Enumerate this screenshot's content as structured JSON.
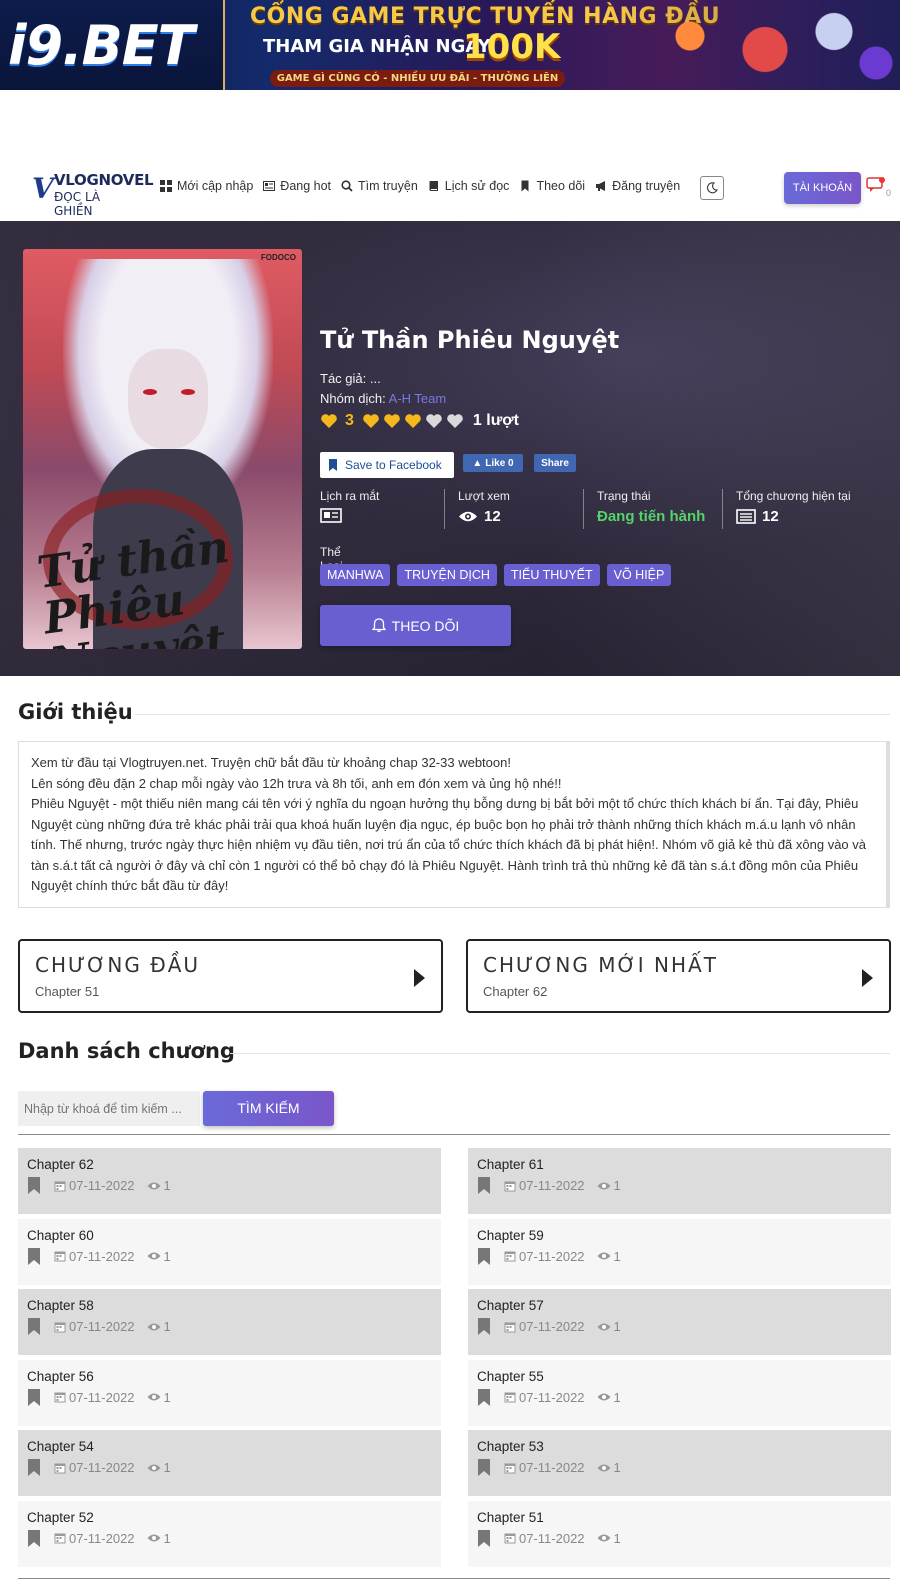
{
  "banner": {
    "brand": "i9.BET",
    "headline": "CỔNG GAME TRỰC TUYẾN HÀNG ĐẦU",
    "subline": "THAM GIA NHẬN NGAY",
    "promo": "100K",
    "tagline": "GAME GÌ CŨNG CÓ - NHIỀU ƯU ĐÃI - THƯỞNG LIÊN TỤC"
  },
  "site": {
    "logo_main": "VLOGNOVEL",
    "logo_sub": "ĐỌC LÀ GHIỀN"
  },
  "nav": {
    "items": [
      {
        "label": "Mới cập nhập",
        "icon": "grid-icon"
      },
      {
        "label": "Đang hot",
        "icon": "newspaper-icon"
      },
      {
        "label": "Tìm truyện",
        "icon": "search-icon"
      },
      {
        "label": "Lịch sử đọc",
        "icon": "book-icon"
      },
      {
        "label": "Theo dõi",
        "icon": "bookmark-icon"
      },
      {
        "label": "Đăng truyện",
        "icon": "megaphone-icon"
      }
    ],
    "account_label": "TÀI KHOẢN",
    "notif_count": "0"
  },
  "manga": {
    "cover_publisher": "FODOCO",
    "cover_title_art": "Tử thần Phiêu Nguyệt",
    "title": "Tử Thần Phiêu Nguyệt",
    "author_label": "Tác giả:",
    "author": "...",
    "group_label": "Nhóm dịch:",
    "group": "A-H Team",
    "rating_score": "3",
    "rating_hearts_filled": 3,
    "rating_hearts_total": 5,
    "rating_votes": "1 lượt",
    "fb_save_label": "Save to Facebook",
    "fb_like_label": "Like 0",
    "fb_share_label": "Share",
    "stats": {
      "release_label": "Lịch ra mắt",
      "views_label": "Lượt xem",
      "views": "12",
      "status_label": "Trạng thái",
      "status": "Đang tiến hành",
      "chapters_label": "Tổng chương hiện tại",
      "chapters": "12"
    },
    "genre_label": "Thể Loại",
    "genres": [
      "MANHWA",
      "TRUYỆN DỊCH",
      "TIỂU THUYẾT",
      "VÕ HIỆP"
    ],
    "follow_label": "THEO DÕI"
  },
  "intro": {
    "title": "Giới thiệu",
    "lines": [
      "Xem từ đầu tại Vlogtruyen.net. Truyện chữ bắt đầu từ khoảng chap 32-33 webtoon!",
      "Lên sóng đều đặn 2 chap mỗi ngày vào 12h trưa và 8h tối, anh em đón xem và ủng hộ nhé!!",
      "Phiêu Nguyệt - một thiếu niên mang cái tên với ý nghĩa du ngoạn hưởng thụ bỗng dưng bị bắt bởi một tổ chức thích khách bí ẩn. Tại đây, Phiêu Nguyệt cùng những đứa trẻ khác phải trải qua khoá huấn luyện địa ngục, ép buộc bọn họ phải trở thành những thích khách m.á.u lạnh vô nhân tính. Thế nhưng, trước ngày thực hiện nhiệm vụ đầu tiên, nơi trú ẩn của tổ chức thích khách đã bị phát hiện!. Nhóm võ giả kẻ thù đã xông vào và tàn s.á.t tất cả người ở đây và chỉ còn 1 người có thể bỏ chạy đó là Phiêu Nguyệt. Hành trình trả thù những kẻ đã tàn s.á.t đồng môn của Phiêu Nguyệt chính thức bắt đầu từ đây!"
    ]
  },
  "jump": {
    "first_title": "CHƯƠNG ĐẦU",
    "first_chapter": "Chapter 51",
    "latest_title": "CHƯƠNG MỚI NHẤT",
    "latest_chapter": "Chapter 62"
  },
  "chapter_list": {
    "title": "Danh sách chương",
    "search_placeholder": "Nhập từ khoá để tìm kiếm ...",
    "search_button": "TÌM KIẾM",
    "chapters": [
      {
        "name": "Chapter 62",
        "date": "07-11-2022",
        "views": "1"
      },
      {
        "name": "Chapter 61",
        "date": "07-11-2022",
        "views": "1"
      },
      {
        "name": "Chapter 60",
        "date": "07-11-2022",
        "views": "1"
      },
      {
        "name": "Chapter 59",
        "date": "07-11-2022",
        "views": "1"
      },
      {
        "name": "Chapter 58",
        "date": "07-11-2022",
        "views": "1"
      },
      {
        "name": "Chapter 57",
        "date": "07-11-2022",
        "views": "1"
      },
      {
        "name": "Chapter 56",
        "date": "07-11-2022",
        "views": "1"
      },
      {
        "name": "Chapter 55",
        "date": "07-11-2022",
        "views": "1"
      },
      {
        "name": "Chapter 54",
        "date": "07-11-2022",
        "views": "1"
      },
      {
        "name": "Chapter 53",
        "date": "07-11-2022",
        "views": "1"
      },
      {
        "name": "Chapter 52",
        "date": "07-11-2022",
        "views": "1"
      },
      {
        "name": "Chapter 51",
        "date": "07-11-2022",
        "views": "1"
      }
    ]
  },
  "colors": {
    "accent": "#6a5fd0",
    "status_green": "#54d36b",
    "heart_filled": "#f5b81c",
    "heart_empty": "#d9d9d9"
  }
}
